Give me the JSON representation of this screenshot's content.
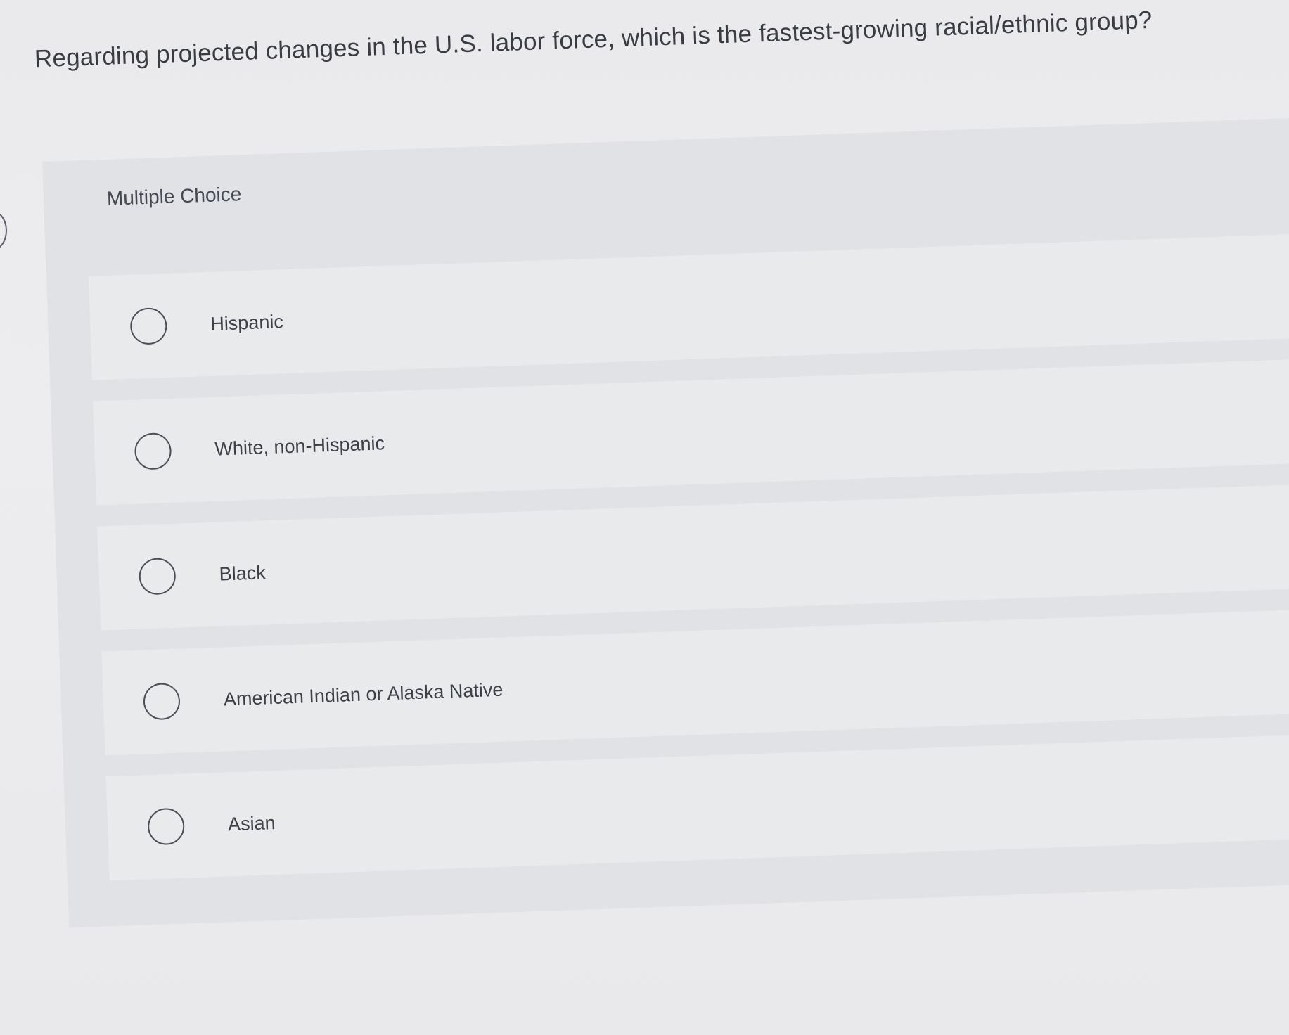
{
  "question": {
    "text": "Regarding projected changes in the U.S. labor force, which is the fastest-growing racial/ethnic group?"
  },
  "multiple_choice": {
    "label": "Multiple Choice",
    "options": [
      {
        "label": "Hispanic",
        "selected": false
      },
      {
        "label": "White, non-Hispanic",
        "selected": false
      },
      {
        "label": "Black",
        "selected": false
      },
      {
        "label": "American Indian or Alaska Native",
        "selected": false
      },
      {
        "label": "Asian",
        "selected": false
      }
    ]
  },
  "colors": {
    "background": "#ebebed",
    "panel": "#e1e2e5",
    "option_row": "#e9eaec",
    "text": "#3a3c44",
    "radio_border": "#4c4e58"
  }
}
